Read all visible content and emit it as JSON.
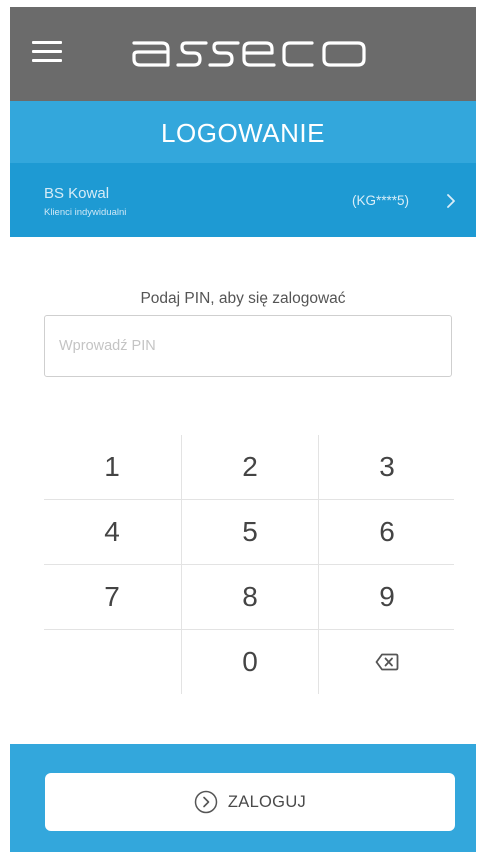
{
  "header": {
    "menu_icon": "hamburger-menu-icon",
    "logo_text": "asseco"
  },
  "title_bar": {
    "title": "LOGOWANIE"
  },
  "account": {
    "name": "BS Kowal",
    "subtitle": "Klienci indywidualni",
    "code": "(KG****5)",
    "chevron_icon": "chevron-right-icon"
  },
  "pin": {
    "prompt": "Podaj PIN, aby się zalogować",
    "placeholder": "Wprowadź PIN",
    "value": ""
  },
  "keypad": {
    "rows": [
      [
        "1",
        "2",
        "3"
      ],
      [
        "4",
        "5",
        "6"
      ],
      [
        "7",
        "8",
        "9"
      ],
      [
        "",
        "0",
        ""
      ]
    ],
    "backspace_icon": "backspace-icon"
  },
  "login": {
    "label": "ZALOGUJ",
    "icon": "circle-chevron-right-icon"
  },
  "colors": {
    "topbar": "#6b6b6b",
    "accent": "#33a7dc",
    "account_bar": "#1e9ad3"
  }
}
